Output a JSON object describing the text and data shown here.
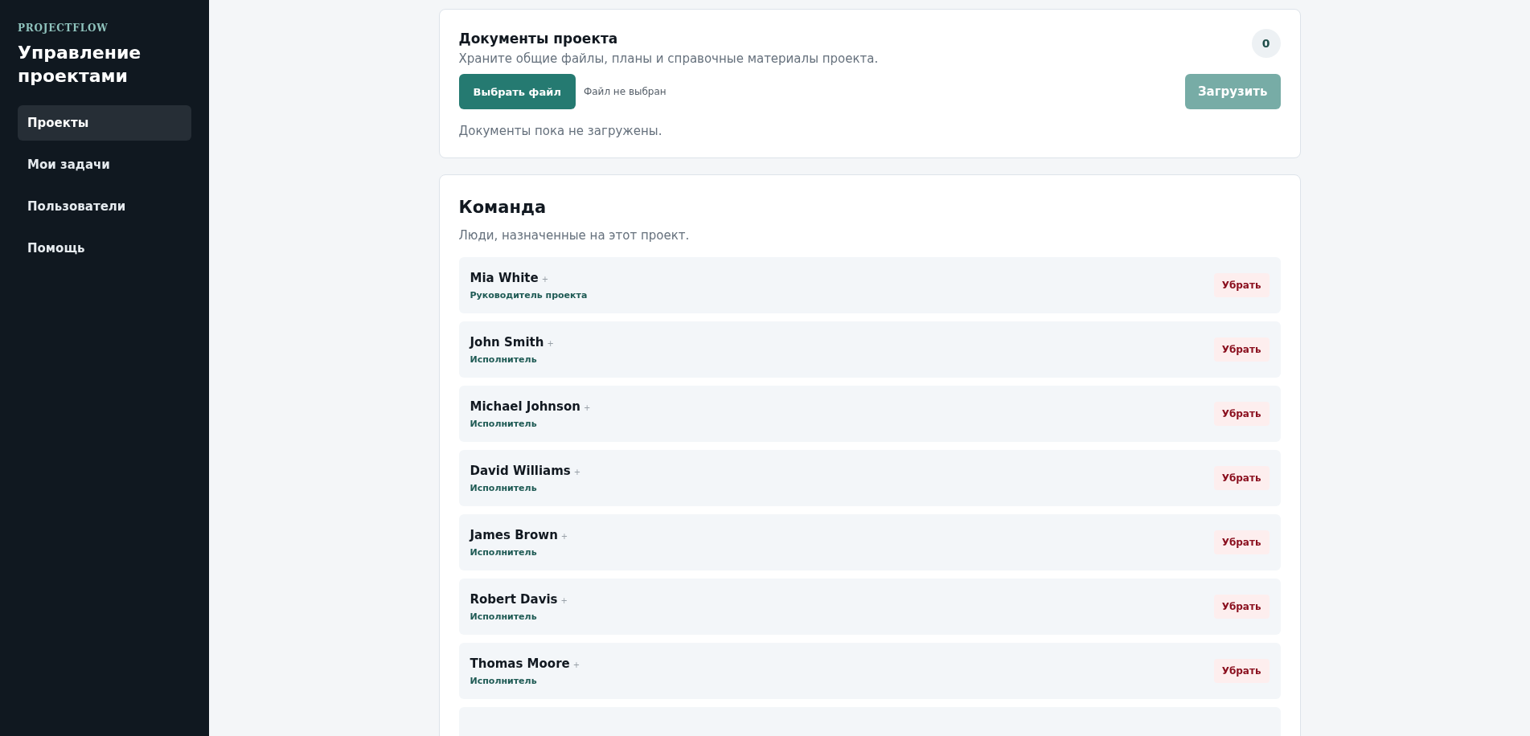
{
  "sidebar": {
    "brand": "PROJECTFLOW",
    "title": "Управление проектами",
    "items": [
      {
        "label": "Проекты",
        "selected": true
      },
      {
        "label": "Мои задачи",
        "selected": false
      },
      {
        "label": "Пользователи",
        "selected": false
      },
      {
        "label": "Помощь",
        "selected": false
      }
    ]
  },
  "documents": {
    "title": "Документы проекта",
    "subtitle": "Храните общие файлы, планы и справочные материалы проекта.",
    "count": "0",
    "choose_button": "Выбрать файл",
    "file_status": "Файл не выбран",
    "upload_button": {
      "label": "Загрузить",
      "disabled": true
    },
    "empty_text": "Документы пока не загружены."
  },
  "team": {
    "title": "Команда",
    "subtitle": "Люди, назначенные на этот проект.",
    "members": [
      {
        "name": "Mia White",
        "mark": "+",
        "role": "Руководитель проекта",
        "action": "Убрать"
      },
      {
        "name": "John Smith",
        "mark": "+",
        "role": "Исполнитель",
        "action": "Убрать"
      },
      {
        "name": "Michael Johnson",
        "mark": "+",
        "role": "Исполнитель",
        "action": "Убрать"
      },
      {
        "name": "David Williams",
        "mark": "+",
        "role": "Исполнитель",
        "action": "Убрать"
      },
      {
        "name": "James Brown",
        "mark": "+",
        "role": "Исполнитель",
        "action": "Убрать"
      },
      {
        "name": "Robert Davis",
        "mark": "+",
        "role": "Исполнитель",
        "action": "Убрать"
      },
      {
        "name": "Thomas Moore",
        "mark": "+",
        "role": "Исполнитель",
        "action": "Убрать"
      }
    ]
  }
}
